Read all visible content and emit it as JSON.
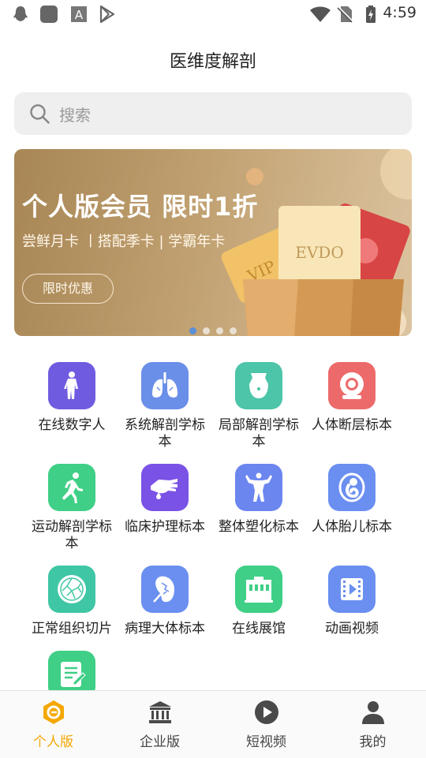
{
  "status_bar": {
    "time": "4:59"
  },
  "header": {
    "title": "医维度解剖"
  },
  "search": {
    "placeholder": "搜索"
  },
  "banner": {
    "headline": "个人版会员 限时1折",
    "subline": "尝鲜月卡 丨搭配季卡 | 学霸年卡",
    "button": "限时优惠",
    "card_vip": "VIP",
    "card_evdo": "EVDO",
    "page_count": 4,
    "active_page": 1
  },
  "grid": {
    "items": [
      {
        "label": "在线数字人",
        "icon": "human-figure-icon",
        "color": "#6f5be0"
      },
      {
        "label": "系统解剖学标本",
        "icon": "lungs-icon",
        "color": "#6a8fe8"
      },
      {
        "label": "局部解剖学标本",
        "icon": "torso-icon",
        "color": "#4cc5a8"
      },
      {
        "label": "人体断层标本",
        "icon": "ct-scanner-icon",
        "color": "#ec6a6a"
      },
      {
        "label": "运动解剖学标本",
        "icon": "running-man-icon",
        "color": "#3fcf86"
      },
      {
        "label": "临床护理标本",
        "icon": "hand-drop-icon",
        "color": "#7a52e6"
      },
      {
        "label": "整体塑化标本",
        "icon": "bodybuilder-icon",
        "color": "#6c86f0"
      },
      {
        "label": "人体胎儿标本",
        "icon": "fetus-icon",
        "color": "#6a8ff0"
      },
      {
        "label": "正常组织切片",
        "icon": "tissue-slice-icon",
        "color": "#3fc6a4"
      },
      {
        "label": "病理大体标本",
        "icon": "pathology-organ-icon",
        "color": "#6a8ff0"
      },
      {
        "label": "在线展馆",
        "icon": "museum-icon",
        "color": "#3fcf86"
      },
      {
        "label": "动画视频",
        "icon": "video-icon",
        "color": "#6a8ff0"
      },
      {
        "label": "",
        "icon": "notes-icon",
        "color": "#3fcf86"
      }
    ]
  },
  "tabbar": {
    "tabs": [
      {
        "label": "个人版",
        "icon": "personal-icon"
      },
      {
        "label": "企业版",
        "icon": "bank-icon"
      },
      {
        "label": "短视频",
        "icon": "play-icon"
      },
      {
        "label": "我的",
        "icon": "user-icon"
      }
    ],
    "active": 0,
    "active_color": "#f4a800"
  }
}
